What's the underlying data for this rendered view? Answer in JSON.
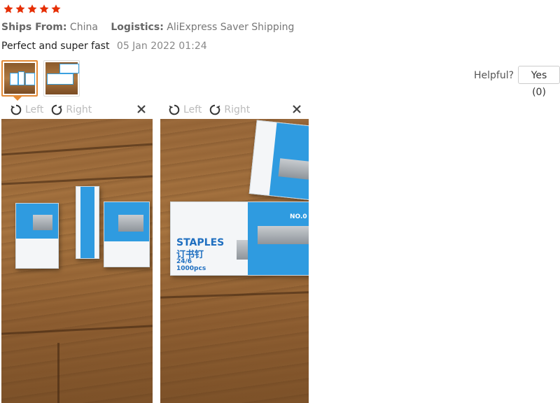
{
  "review": {
    "rating": 5,
    "rating_max": 5,
    "star_color": "#e62e04",
    "ships_from_label": "Ships From:",
    "ships_from_value": "China",
    "logistics_label": "Logistics:",
    "logistics_value": "AliExpress Saver Shipping",
    "text": "Perfect and super fast",
    "date": "05 Jan 2022 01:24"
  },
  "thumbnails": [
    {
      "name": "review-photo-1",
      "selected": true
    },
    {
      "name": "review-photo-2",
      "selected": false
    }
  ],
  "feedback": {
    "helpful_label": "Helpful?",
    "yes_button": "Yes (0)"
  },
  "viewers": [
    {
      "rotate_left": "Left",
      "rotate_right": "Right",
      "close_icon": "close-icon"
    },
    {
      "rotate_left": "Left",
      "rotate_right": "Right",
      "close_icon": "close-icon"
    }
  ],
  "photo_text": {
    "brand": "STAPLES",
    "chinese": "订书钉",
    "size": "24/6",
    "count": "1000pcs",
    "model": "NO.0"
  },
  "colors": {
    "accent": "#e48a35",
    "muted_text": "#888888",
    "package_blue": "#2f9be0"
  }
}
